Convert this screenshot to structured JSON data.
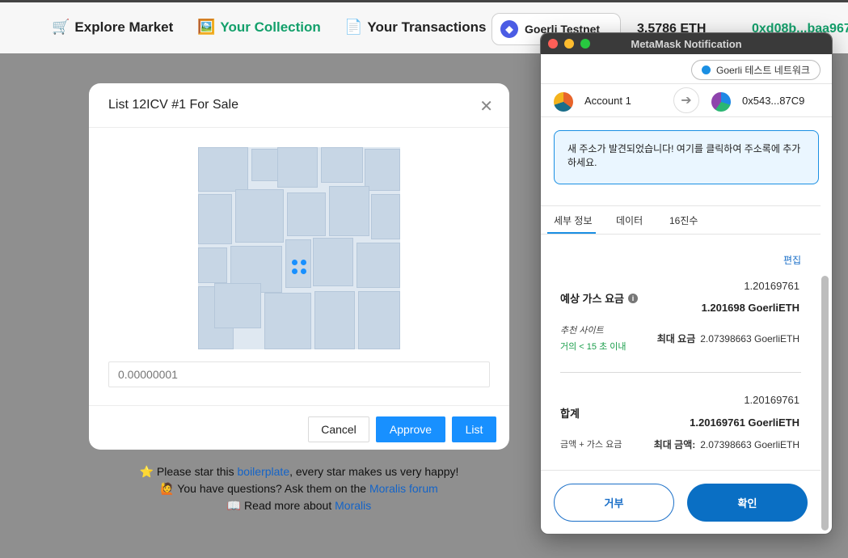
{
  "nav": {
    "explore_icon": "🛒",
    "explore_label": "Explore Market",
    "collection_icon": "🖼️",
    "collection_label": "Your Collection",
    "transactions_icon": "📄",
    "transactions_label": "Your Transactions",
    "network_label": "Goerli Testnet",
    "balance": "3.5786 ETH",
    "address": "0xd08b...baa967",
    "accent_color": "#13a06b"
  },
  "modal": {
    "title": "List 12ICV #1 For Sale",
    "close_glyph": "✕",
    "price_placeholder": "0.00000001",
    "cancel_label": "Cancel",
    "approve_label": "Approve",
    "list_label": "List"
  },
  "footer": {
    "line1_prefix": "⭐ Please star this ",
    "line1_link": "boilerplate",
    "line1_suffix": ", every star makes us very happy!",
    "line2_prefix": "🙋 You have questions? Ask them on the ",
    "line2_link": "Moralis forum",
    "line3_prefix": "📖 Read more about ",
    "line3_link": "Moralis"
  },
  "metamask": {
    "window_title": "MetaMask Notification",
    "network_label": "Goerli 테스트 네트워크",
    "from_account": "Account 1",
    "to_address": "0x543...87C9",
    "notice": "새 주소가 발견되었습니다! 여기를 클릭하여 주소록에 추가하세요.",
    "tabs": [
      "세부 정보",
      "데이터",
      "16진수"
    ],
    "edit_label": "편집",
    "gas": {
      "label": "예상 가스 요금",
      "value_plain": "1.20169761",
      "value_bold": "1.201698 GoerliETH",
      "recommend_label": "추천 사이트",
      "time_label": "거의 < 15 초 이내",
      "max_label": "최대 요금",
      "max_value": "2.07398663 GoerliETH"
    },
    "total": {
      "label": "합계",
      "value_plain": "1.20169761",
      "value_bold": "1.20169761 GoerliETH",
      "sub_label": "금액 + 가스 요금",
      "max_label": "최대 금액:",
      "max_value": "2.07398663 GoerliETH"
    },
    "reject_label": "거부",
    "confirm_label": "확인"
  }
}
